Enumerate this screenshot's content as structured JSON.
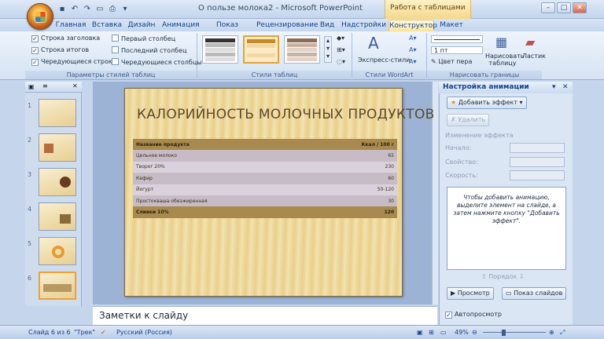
{
  "window": {
    "title": "О пользе молока2 - Microsoft PowerPoint",
    "context_tab_group": "Работа с таблицами"
  },
  "tabs": [
    {
      "label": "Главная"
    },
    {
      "label": "Вставка"
    },
    {
      "label": "Дизайн"
    },
    {
      "label": "Анимация"
    },
    {
      "label": "Показ слайдов"
    },
    {
      "label": "Рецензирование"
    },
    {
      "label": "Вид"
    },
    {
      "label": "Надстройки"
    },
    {
      "label": "Конструктор"
    },
    {
      "label": "Макет"
    }
  ],
  "ribbon": {
    "table_style_options": {
      "header_row": "Строка заголовка",
      "total_row": "Строка итогов",
      "banded_rows": "Чередующиеся строки",
      "first_column": "Первый столбец",
      "last_column": "Последний столбец",
      "banded_columns": "Чередующиеся столбцы",
      "group_label": "Параметры стилей таблиц"
    },
    "table_styles_label": "Стили таблиц",
    "wordart": {
      "quick_styles": "Экспресс-стили",
      "group_label": "Стили WordArt"
    },
    "borders": {
      "pen_weight": "1 пт",
      "pen_color": "Цвет пера",
      "draw_table": "Нарисовать таблицу",
      "eraser": "Ластик",
      "group_label": "Нарисовать границы"
    }
  },
  "slide": {
    "title": "КАЛОРИЙНОСТЬ МОЛОЧНЫХ ПРОДУКТОВ",
    "table": {
      "header": [
        "Название продукта",
        "Ккал / 100 г"
      ],
      "rows": [
        [
          "Цельное молоко",
          "65"
        ],
        [
          "Творог 20%",
          "230"
        ],
        [
          "Кефир",
          "60"
        ],
        [
          "Йогурт",
          "50-120"
        ],
        [
          "Простокваша обезжиренная",
          "30"
        ]
      ],
      "total": [
        "Сливки 10%",
        "120"
      ]
    }
  },
  "notes_placeholder": "Заметки к слайду",
  "slide_numbers": [
    "1",
    "2",
    "3",
    "4",
    "5",
    "6"
  ],
  "task_pane": {
    "title": "Настройка анимации",
    "add_effect": "Добавить эффект",
    "remove": "Удалить",
    "change_effect": "Изменение эффекта",
    "start_label": "Начало:",
    "property_label": "Свойство:",
    "speed_label": "Скорость:",
    "info_text": "Чтобы добавить анимацию, выделите элемент на слайде, а затем нажмите кнопку \"Добавить эффект\".",
    "order_label": "Порядок",
    "play": "Просмотр",
    "slideshow": "Показ слайдов",
    "autopreview": "Автопросмотр"
  },
  "status_bar": {
    "slide_info": "Слайд 6 из 6",
    "theme": "\"Трек\"",
    "language": "Русский (Россия)",
    "zoom": "49%"
  }
}
